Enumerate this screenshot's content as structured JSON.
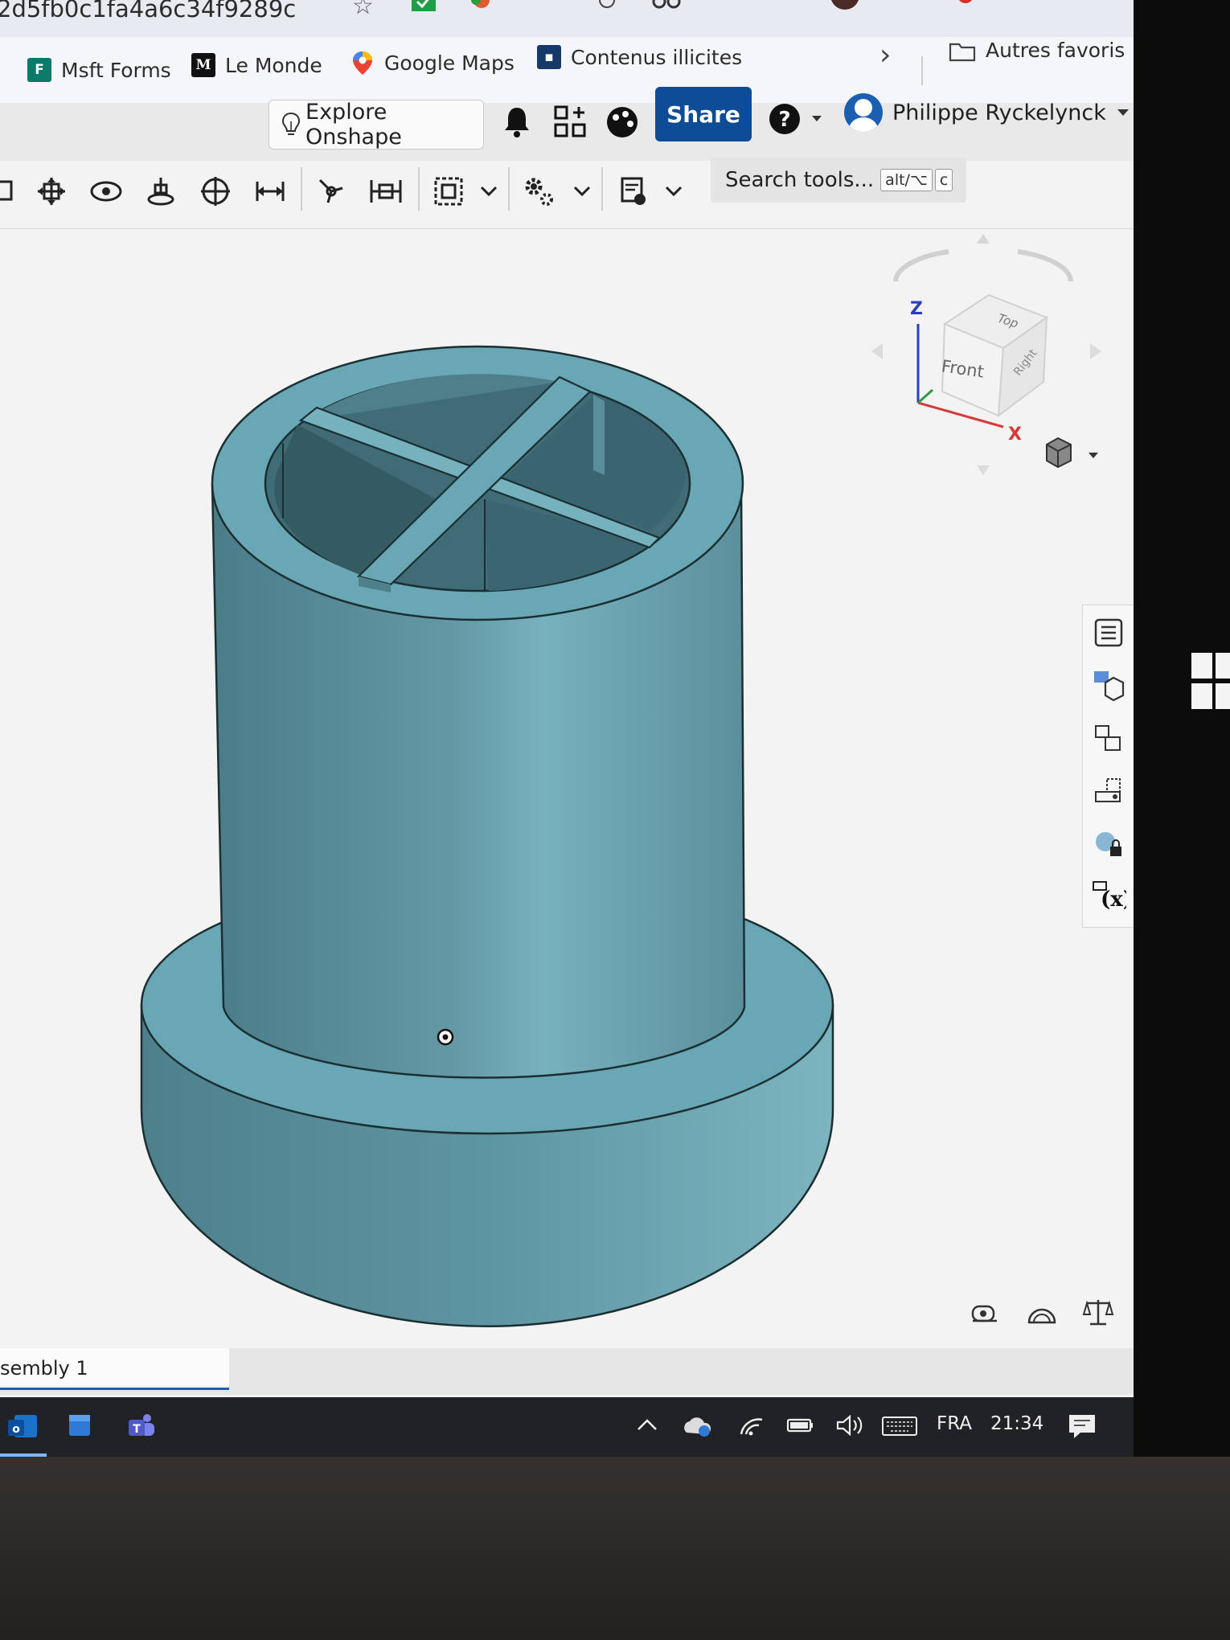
{
  "browser": {
    "url_fragment": "2d5fb0c1fa4a6c34f9289c",
    "bookmarks": [
      {
        "label": "Msft Forms",
        "icon": "forms-icon"
      },
      {
        "label": "Le Monde",
        "icon": "le-monde-icon"
      },
      {
        "label": "Google Maps",
        "icon": "maps-pin-icon"
      },
      {
        "label": "Contenus illicites",
        "icon": "site-icon"
      }
    ],
    "other_bookmarks": "Autres favoris"
  },
  "header": {
    "explore_label": "Explore Onshape",
    "share_label": "Share",
    "user_name": "Philippe Ryckelynck"
  },
  "toolbar": {
    "search_placeholder": "Search tools...",
    "shortcut_1": "alt/⌥",
    "shortcut_2": "c"
  },
  "view_cube": {
    "faces": {
      "top": "Top",
      "front": "Front",
      "right": "Right"
    },
    "axes": {
      "z": "Z",
      "x": "X"
    },
    "colors": {
      "z": "#2a3fb8",
      "x": "#d63a3a",
      "y": "#2e9a3e"
    }
  },
  "model": {
    "color": "#6aa7b5"
  },
  "tabs": {
    "active": "sembly 1"
  },
  "taskbar": {
    "language": "FRA",
    "time": "21:34"
  },
  "colors": {
    "share": "#0e4d95",
    "accent": "#1a5fb0"
  }
}
